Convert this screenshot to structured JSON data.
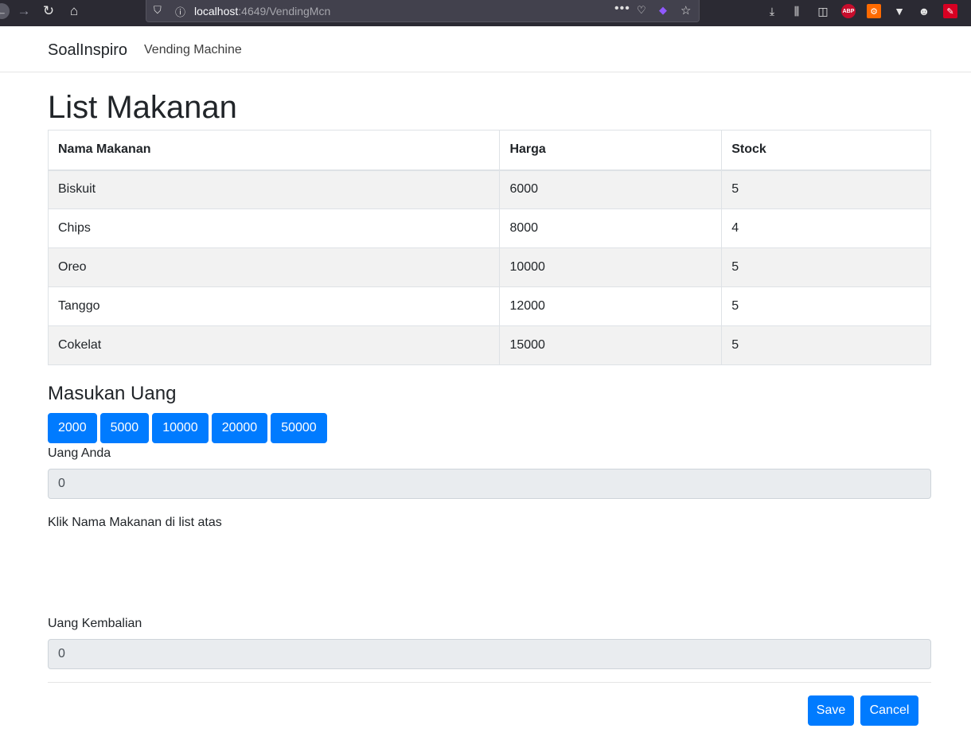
{
  "browser": {
    "url_host": "localhost",
    "url_rest": ":4649/VendingMcn",
    "icons": [
      "back-icon",
      "forward-icon",
      "reload-icon",
      "home-icon",
      "shield-icon",
      "info-icon",
      "more-icon",
      "pocket-icon",
      "extension-icon",
      "bookmark-star-icon",
      "download-icon",
      "library-icon",
      "sidebar-icon",
      "adblock-icon",
      "extension-orange-icon",
      "vivaldi-icon",
      "account-icon",
      "extension-red-icon"
    ],
    "abp_label": "ABP"
  },
  "navbar": {
    "brand": "SoalInspiro",
    "link": "Vending Machine"
  },
  "main": {
    "title": "List Makanan",
    "table": {
      "headers": [
        "Nama Makanan",
        "Harga",
        "Stock"
      ],
      "rows": [
        [
          "Biskuit",
          "6000",
          "5"
        ],
        [
          "Chips",
          "8000",
          "4"
        ],
        [
          "Oreo",
          "10000",
          "5"
        ],
        [
          "Tanggo",
          "12000",
          "5"
        ],
        [
          "Cokelat",
          "15000",
          "5"
        ]
      ]
    },
    "money_title": "Masukan Uang",
    "coins": [
      "2000",
      "5000",
      "10000",
      "20000",
      "50000"
    ],
    "uang_anda_label": "Uang Anda",
    "uang_anda_value": "0",
    "hint": "Klik Nama Makanan di list atas",
    "kembalian_label": "Uang Kembalian",
    "kembalian_value": "0",
    "save_label": "Save",
    "cancel_label": "Cancel"
  },
  "colors": {
    "primary": "#007bff",
    "readonly_bg": "#e9ecef",
    "stripe": "#f2f2f2",
    "chrome": "#2b2a33"
  }
}
